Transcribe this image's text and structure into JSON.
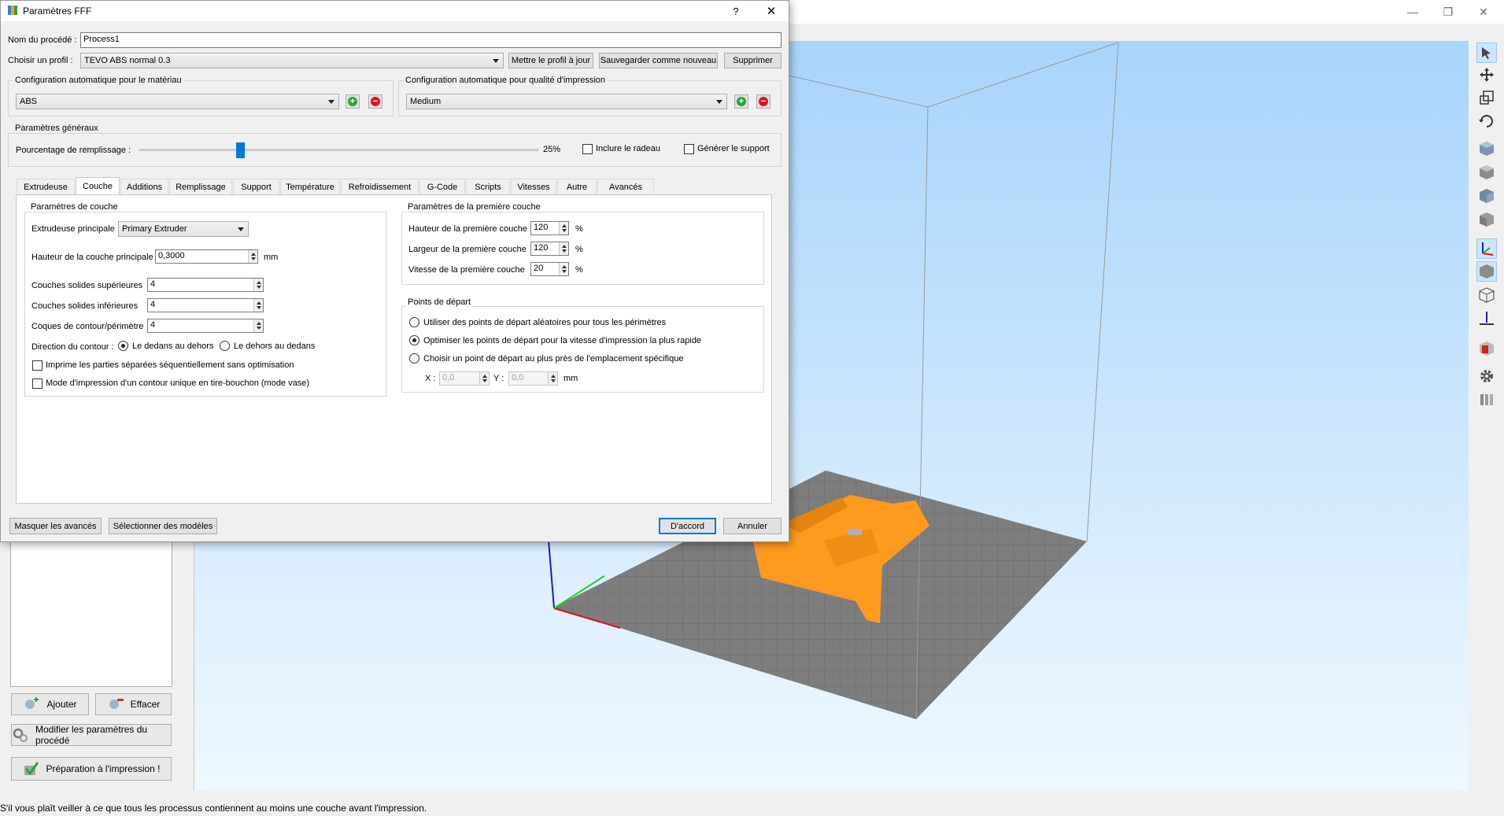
{
  "app": {
    "status_text": "S'il vous plaît veiller à ce que tous les processus contiennent au moins une couche avant l'impression.",
    "buttons": {
      "add": "Ajouter",
      "clear": "Effacer",
      "edit_process": "Modifier les paramètres du procédé",
      "prepare": "Préparation à l'impression !"
    },
    "window_controls": {
      "minimize": "—",
      "maximize": "❐",
      "close": "✕"
    }
  },
  "dialog": {
    "title": "Paramètres FFF",
    "help": "?",
    "close": "✕",
    "process_name_label": "Nom du procédé :",
    "process_name_value": "Process1",
    "profile_label": "Choisir un profil :",
    "profile_value": "TEVO ABS normal 0.3",
    "update_profile": "Mettre le profil à jour",
    "save_as_new": "Sauvegarder comme nouveau",
    "delete": "Supprimer",
    "material_group": "Configuration automatique pour le matériau",
    "material_value": "ABS",
    "quality_group": "Configuration automatique pour qualité d'impression",
    "quality_value": "Medium",
    "general_group": "Paramètres généraux",
    "infill_label": "Pourcentage de remplissage :",
    "infill_value": "25%",
    "infill_fraction": 0.25,
    "include_raft": "Inclure le radeau",
    "generate_support": "Générer le support",
    "tabs": [
      "Extrudeuse",
      "Couche",
      "Additions",
      "Remplissage",
      "Support",
      "Température",
      "Refroidissement",
      "G-Code",
      "Scripts",
      "Vitesses",
      "Autre",
      "Avancés"
    ],
    "active_tab": "Couche",
    "layer": {
      "group": "Paramètres de couche",
      "main_extruder_label": "Extrudeuse principale",
      "main_extruder_value": "Primary Extruder",
      "layer_height_label": "Hauteur de la couche principale",
      "layer_height_value": "0,3000",
      "layer_height_unit": "mm",
      "top_layers_label": "Couches solides supérieures",
      "top_layers_value": "4",
      "bottom_layers_label": "Couches solides inférieures",
      "bottom_layers_value": "4",
      "shells_label": "Coques de contour/périmètre",
      "shells_value": "4",
      "direction_label": "Direction du contour :",
      "direction_inside_out": "Le dedans au dehors",
      "direction_outside_in": "Le dehors au dedans",
      "sequential": "Imprime les parties séparées séquentiellement sans optimisation",
      "vase_mode": "Mode d'impression d'un contour unique en tire-bouchon (mode vase)"
    },
    "first_layer": {
      "group": "Paramètres de la première couche",
      "height_label": "Hauteur de la première couche",
      "height_value": "120",
      "width_label": "Largeur de la première couche",
      "width_value": "120",
      "speed_label": "Vitesse de la première couche",
      "speed_value": "20",
      "unit": "%"
    },
    "start_points": {
      "group": "Points de départ",
      "random": "Utiliser des points de départ aléatoires pour tous les périmètres",
      "optimize": "Optimiser les points de départ pour la vitesse d'impression la plus rapide",
      "specific": "Choisir un point de départ au plus près de l'emplacement spécifique",
      "x_label": "X :",
      "x_value": "0,0",
      "y_label": "Y :",
      "y_value": "0,0",
      "unit": "mm"
    },
    "hide_advanced": "Masquer les avancés",
    "select_models": "Sélectionner des modèles",
    "ok": "D'accord",
    "cancel": "Annuler"
  },
  "colors": {
    "accent": "#0078d7",
    "model": "#ff9a1f",
    "bed": "#7d7d7d",
    "add_icon": "#2aa43a",
    "remove_icon": "#e0141e"
  }
}
